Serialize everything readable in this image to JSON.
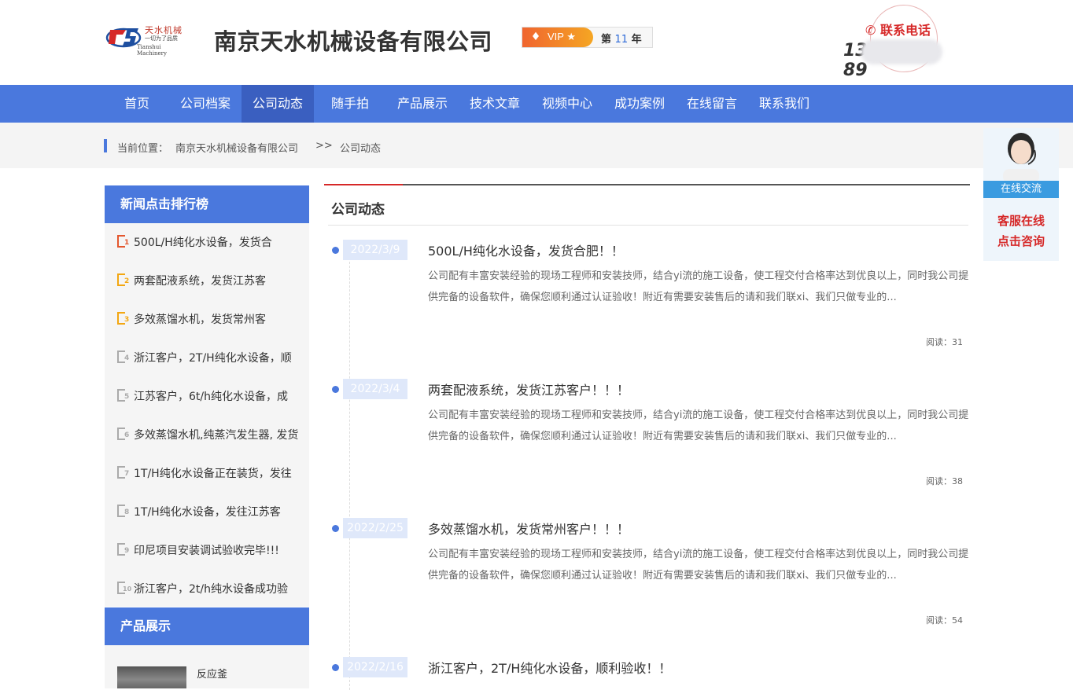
{
  "header": {
    "logo": {
      "cn": "天水机械",
      "slogan": "一切为了品质",
      "en": "Tianshui Machinery",
      "mark": "TS"
    },
    "company_name": "南京天水机械设备有限公司",
    "vip": {
      "label": "VIP ★",
      "year_prefix": "第",
      "year_num": "11",
      "year_suffix": "年"
    },
    "contact": {
      "label": "联系电话",
      "phone_visible_start": "13",
      "phone_visible_end": "89",
      "icon": "phone-icon"
    }
  },
  "nav": {
    "items": [
      {
        "label": "首页"
      },
      {
        "label": "公司档案"
      },
      {
        "label": "公司动态"
      },
      {
        "label": "随手拍"
      },
      {
        "label": "产品展示"
      },
      {
        "label": "技术文章"
      },
      {
        "label": "视频中心"
      },
      {
        "label": "成功案例"
      },
      {
        "label": "在线留言"
      },
      {
        "label": "联系我们"
      }
    ],
    "active_index": 2
  },
  "breadcrumb": {
    "prefix": "当前位置：",
    "home": "南京天水机械设备有限公司",
    "sep": ">>",
    "current": "公司动态"
  },
  "sidebar": {
    "news_title": "新闻点击排行榜",
    "news": [
      {
        "rank": "1",
        "title": "500L/H纯化水设备，发货合"
      },
      {
        "rank": "2",
        "title": "两套配液系统，发货江苏客"
      },
      {
        "rank": "3",
        "title": "多效蒸馏水机，发货常州客"
      },
      {
        "rank": "4",
        "title": "浙江客户，2T/H纯化水设备，顺"
      },
      {
        "rank": "5",
        "title": "江苏客户，6t/h纯化水设备，成"
      },
      {
        "rank": "6",
        "title": "多效蒸馏水机,纯蒸汽发生器, 发货"
      },
      {
        "rank": "7",
        "title": "1T/H纯化水设备正在装货，发往"
      },
      {
        "rank": "8",
        "title": "1T/H纯化水设备，发往江苏客"
      },
      {
        "rank": "9",
        "title": "印尼项目安装调试验收完毕!!!"
      },
      {
        "rank": "10",
        "title": "浙江客户，2t/h纯水设备成功验"
      }
    ],
    "products_title": "产品展示",
    "products": [
      {
        "name": "反应釜"
      }
    ]
  },
  "main": {
    "title": "公司动态",
    "articles": [
      {
        "date": "2022/3/9",
        "title": "500L/H纯化水设备，发货合肥！！",
        "body": "公司配有丰富安装经验的现场工程师和安装技师，结合yi流的施工设备，使工程交付合格率达到优良以上，同时我公司提供完备的设备软件，确保您顺利通过认证验收！附近有需要安装售后的请和我们联xi、我们只做专业的...",
        "reads": "阅读：31"
      },
      {
        "date": "2022/3/4",
        "title": "两套配液系统，发货江苏客户！！！",
        "body": "公司配有丰富安装经验的现场工程师和安装技师，结合yi流的施工设备，使工程交付合格率达到优良以上，同时我公司提供完备的设备软件，确保您顺利通过认证验收！附近有需要安装售后的请和我们联xi、我们只做专业的...",
        "reads": "阅读：38"
      },
      {
        "date": "2022/2/25",
        "title": "多效蒸馏水机，发货常州客户！！！",
        "body": "公司配有丰富安装经验的现场工程师和安装技师，结合yi流的施工设备，使工程交付合格率达到优良以上，同时我公司提供完备的设备软件，确保您顺利通过认证验收！附近有需要安装售后的请和我们联xi、我们只做专业的...",
        "reads": "阅读：54"
      },
      {
        "date": "2022/2/16",
        "title": "浙江客户，2T/H纯化水设备，顺利验收！！",
        "body": "",
        "reads": ""
      }
    ]
  },
  "service": {
    "tag": "在线交流",
    "line1": "客服在线",
    "line2": "点击咨询",
    "colors": {
      "accent": "#d62828",
      "tag_bg": "#3a9be0"
    }
  },
  "colors": {
    "primary": "#4a78dd",
    "primary_dark": "#3a5fc0",
    "accent_red": "#d62828",
    "date_bg": "#dfe8fa"
  }
}
